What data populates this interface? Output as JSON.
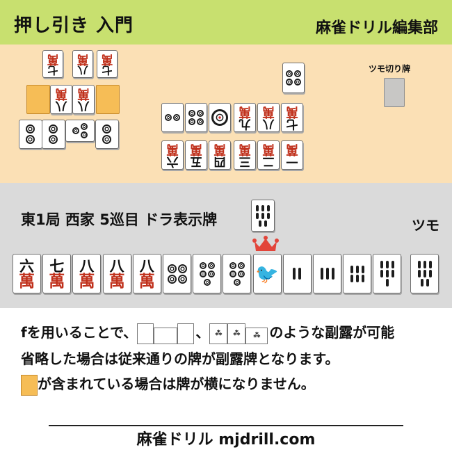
{
  "header": {
    "title": "押し引き 入門",
    "publisher": "麻雀ドリル編集部"
  },
  "tsumogiri_label": "ツモ切り牌",
  "opponent_tiles": [
    {
      "name": "upper-tile-1",
      "suit": "man",
      "rank": "七",
      "rot": 180
    },
    {
      "name": "upper-tile-2",
      "suit": "man",
      "rank": "八",
      "rot": 180
    },
    {
      "name": "upper-tile-3",
      "suit": "man",
      "rank": "七",
      "rot": 180
    },
    {
      "name": "upper-meld-1",
      "suit": "blank",
      "color": "#f6bd56"
    },
    {
      "name": "upper-meld-2",
      "suit": "man",
      "rank": "八",
      "rot": 180
    },
    {
      "name": "upper-meld-3",
      "suit": "man",
      "rank": "八",
      "rot": 180
    },
    {
      "name": "upper-meld-4",
      "suit": "blank",
      "color": "#f6bd56"
    },
    {
      "name": "lower-tile-1",
      "suit": "pin",
      "rank": 2,
      "rot": 90
    },
    {
      "name": "lower-tile-2",
      "suit": "pin",
      "rank": 2,
      "rot": 90
    },
    {
      "name": "lower-tile-3",
      "suit": "pin",
      "rank": 3,
      "rot": 90
    },
    {
      "name": "lower-tile-4",
      "suit": "pin",
      "rank": 2,
      "rot": 90
    },
    {
      "name": "center-top",
      "suit": "pin",
      "rank": 4
    },
    {
      "name": "center-row1-1",
      "suit": "pin",
      "rank": 2
    },
    {
      "name": "center-row1-2",
      "suit": "pin",
      "rank": 4
    },
    {
      "name": "center-row1-3",
      "suit": "pin",
      "rank": 1
    },
    {
      "name": "center-row1-4",
      "suit": "man",
      "rank": "九",
      "rot": 180
    },
    {
      "name": "center-row1-5",
      "suit": "man",
      "rank": "八",
      "rot": 180
    },
    {
      "name": "center-row1-6",
      "suit": "man",
      "rank": "七",
      "rot": 180
    },
    {
      "name": "center-row2-1",
      "suit": "man",
      "rank": "六",
      "rot": 180
    },
    {
      "name": "center-row2-2",
      "suit": "man",
      "rank": "五",
      "rot": 180
    },
    {
      "name": "center-row2-3",
      "suit": "man",
      "rank": "四",
      "rot": 180
    },
    {
      "name": "center-row2-4",
      "suit": "man",
      "rank": "三",
      "rot": 180
    },
    {
      "name": "center-row2-5",
      "suit": "man",
      "rank": "二",
      "rot": 180
    },
    {
      "name": "center-row2-6",
      "suit": "man",
      "rank": "一",
      "rot": 180
    },
    {
      "name": "tsumogiri-tile",
      "suit": "blank",
      "color": "#c8c7c5"
    }
  ],
  "round_info": "東1局 西家 5巡目 ドラ表示牌",
  "dora_indicator": {
    "suit": "sou",
    "rank": 8
  },
  "tsumo_label": "ツモ",
  "hand": [
    {
      "suit": "man",
      "rank": "六"
    },
    {
      "suit": "man",
      "rank": "七"
    },
    {
      "suit": "man",
      "rank": "八"
    },
    {
      "suit": "man",
      "rank": "八"
    },
    {
      "suit": "man",
      "rank": "八"
    },
    {
      "suit": "pin",
      "rank": 4
    },
    {
      "suit": "pin",
      "rank": 5
    },
    {
      "suit": "pin",
      "rank": 5
    },
    {
      "suit": "sou",
      "rank": 1
    },
    {
      "suit": "sou",
      "rank": 2
    },
    {
      "suit": "sou",
      "rank": 3
    },
    {
      "suit": "sou",
      "rank": 6
    },
    {
      "suit": "sou",
      "rank": 7
    }
  ],
  "tsumo_tile": {
    "suit": "sou",
    "rank": 8
  },
  "note": {
    "line1_prefix": "fを用いることで、",
    "line1_sep": "、",
    "line1_suffix": "のような副露が可能",
    "line2": "省略した場合は従来通りの牌が副露牌となります。",
    "line3": "が含まれている場合は牌が横になりません。"
  },
  "footer": "麻雀ドリル mjdrill.com",
  "colors": {
    "header": "#c8e06f",
    "opponent_area": "#fbe0b5",
    "hand_area": "#dadada",
    "meld_marker": "#f6bd56",
    "crown": "#e2453a"
  }
}
